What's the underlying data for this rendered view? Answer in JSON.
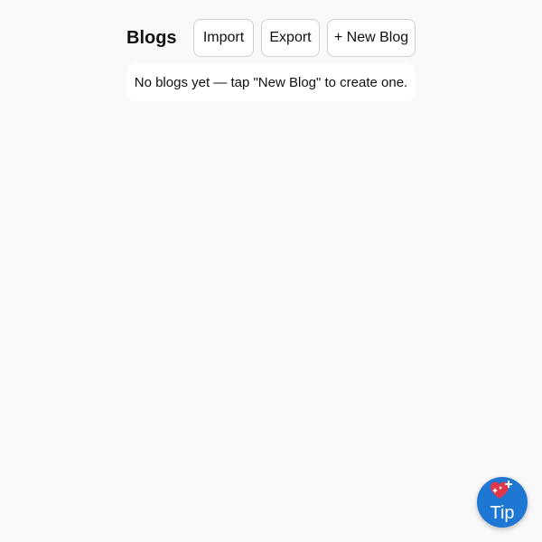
{
  "header": {
    "title": "Blogs",
    "import_label": "Import",
    "export_label": "Export",
    "new_blog_label": "+ New Blog"
  },
  "empty_state": {
    "message": "No blogs yet — tap \"New Blog\" to create one."
  },
  "tip_button": {
    "label": "Tip",
    "icon": "heart-sparkle-icon",
    "color": "#1f77d4"
  },
  "colors": {
    "background": "#f9f9f9",
    "card": "#ffffff",
    "button_border": "#cfcfcf",
    "heart": "#e0384a"
  }
}
